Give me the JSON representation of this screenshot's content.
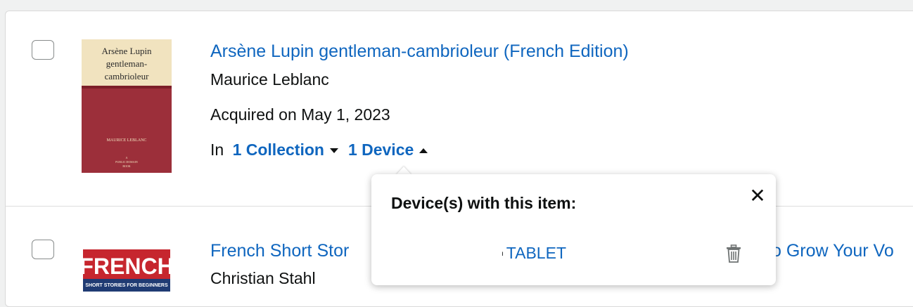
{
  "items": [
    {
      "title": "Arsène Lupin gentleman-cambrioleur (French Edition)",
      "author": "Maurice Leblanc",
      "acquired": "Acquired on May 1, 2023",
      "in_label": "In",
      "collections_label": "1 Collection",
      "devices_label": "1 Device",
      "cover": {
        "title_line1": "Arsène Lupin",
        "title_line2": "gentleman-",
        "title_line3": "cambrioleur",
        "author": "MAURICE LEBLANC",
        "publisher_line1": "A",
        "publisher_line2": "PUBLIC DOMAIN",
        "publisher_line3": "BOOK"
      }
    },
    {
      "title_left": "French Short Stor",
      "title_right": "o Grow Your Vo",
      "author": "Christian Stahl",
      "cover": {
        "title": "FRENCH",
        "subtitle": "SHORT STORIES FOR BEGINNERS"
      }
    }
  ],
  "popover": {
    "title": "Device(s) with this item:",
    "device_name": "TABLET",
    "device_prefix": "ı"
  },
  "icons": {
    "close": "close-icon",
    "trash": "trash-icon",
    "caret_down": "caret-down-icon",
    "caret_up": "caret-up-icon"
  },
  "colors": {
    "link": "#0f66bf",
    "text": "#0f1111",
    "cover_red": "#9c2f3a",
    "cover_paper": "#f1e3bf",
    "french_cover_red": "#c6262e"
  }
}
